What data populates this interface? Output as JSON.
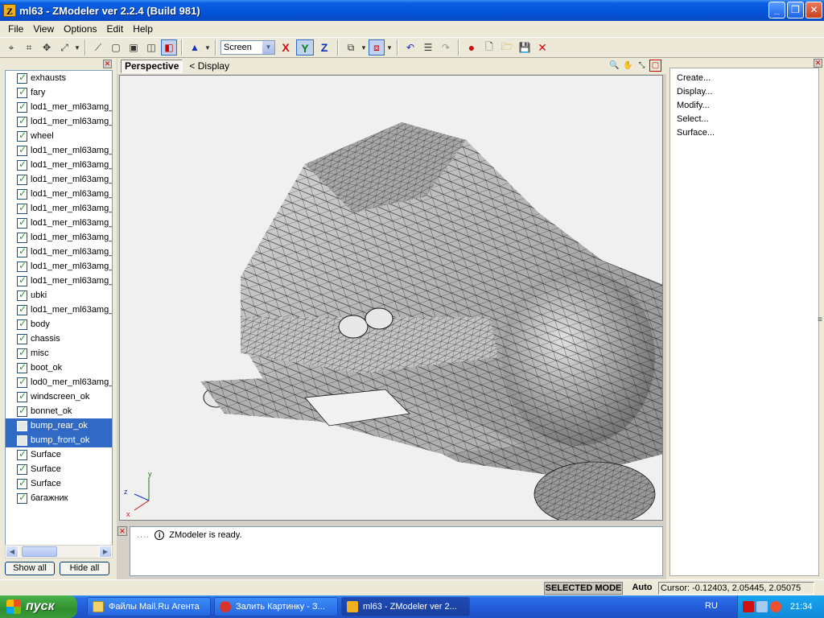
{
  "window": {
    "title": "ml63 - ZModeler ver 2.2.4 (Build 981)",
    "app_icon_letter": "Z",
    "minimize": "_",
    "maximize": "❐",
    "close": "✕"
  },
  "menu": [
    {
      "label": "File"
    },
    {
      "label": "View"
    },
    {
      "label": "Options"
    },
    {
      "label": "Edit"
    },
    {
      "label": "Help"
    }
  ],
  "toolbar": {
    "screen_select": "Screen",
    "axis_x": "X",
    "axis_y": "Y",
    "axis_z": "Z",
    "icons": [
      "select-vertex-icon",
      "select-edge-icon",
      "move-icon",
      "scale-icon",
      "create-polygon-icon",
      "box-view-icon",
      "box-solid-icon",
      "box-wire-icon",
      "box-active-icon",
      "cone-icon",
      "mapping-icon",
      "group-icon",
      "undo-icon",
      "notes-icon",
      "redo-icon",
      "record-icon",
      "new-file-icon",
      "open-file-icon",
      "save-icon",
      "delete-icon"
    ]
  },
  "objects": [
    {
      "label": "exhausts",
      "checked": true,
      "selected": false
    },
    {
      "label": "fary",
      "checked": true,
      "selected": false
    },
    {
      "label": "lod1_mer_ml63amg_(",
      "checked": true,
      "selected": false
    },
    {
      "label": "lod1_mer_ml63amg_(",
      "checked": true,
      "selected": false
    },
    {
      "label": "wheel",
      "checked": true,
      "selected": false
    },
    {
      "label": "lod1_mer_ml63amg_(",
      "checked": true,
      "selected": false
    },
    {
      "label": "lod1_mer_ml63amg_(",
      "checked": true,
      "selected": false
    },
    {
      "label": "lod1_mer_ml63amg_(",
      "checked": true,
      "selected": false
    },
    {
      "label": "lod1_mer_ml63amg_(",
      "checked": true,
      "selected": false
    },
    {
      "label": "lod1_mer_ml63amg_(",
      "checked": true,
      "selected": false
    },
    {
      "label": "lod1_mer_ml63amg_(",
      "checked": true,
      "selected": false
    },
    {
      "label": "lod1_mer_ml63amg_(",
      "checked": true,
      "selected": false
    },
    {
      "label": "lod1_mer_ml63amg_(",
      "checked": true,
      "selected": false
    },
    {
      "label": "lod1_mer_ml63amg_(",
      "checked": true,
      "selected": false
    },
    {
      "label": "lod1_mer_ml63amg_(",
      "checked": true,
      "selected": false
    },
    {
      "label": "ubki",
      "checked": true,
      "selected": false
    },
    {
      "label": "lod1_mer_ml63amg_(",
      "checked": true,
      "selected": false
    },
    {
      "label": "body",
      "checked": true,
      "selected": false
    },
    {
      "label": "chassis",
      "checked": true,
      "selected": false
    },
    {
      "label": "misc",
      "checked": true,
      "selected": false
    },
    {
      "label": "boot_ok",
      "checked": true,
      "selected": false
    },
    {
      "label": "lod0_mer_ml63amg_(",
      "checked": true,
      "selected": false
    },
    {
      "label": "windscreen_ok",
      "checked": true,
      "selected": false
    },
    {
      "label": "bonnet_ok",
      "checked": true,
      "selected": false
    },
    {
      "label": "bump_rear_ok",
      "checked": false,
      "selected": true
    },
    {
      "label": "bump_front_ok",
      "checked": false,
      "selected": true
    },
    {
      "label": "Surface",
      "checked": true,
      "selected": false
    },
    {
      "label": "Surface",
      "checked": true,
      "selected": false
    },
    {
      "label": "Surface",
      "checked": true,
      "selected": false
    },
    {
      "label": "багажник",
      "checked": true,
      "selected": false
    }
  ],
  "left_panel": {
    "show_all": "Show all",
    "hide_all": "Hide all"
  },
  "viewport": {
    "name": "Perspective",
    "display": "< Display",
    "axis_y": "y",
    "axis_z": "z",
    "axis_x": "x"
  },
  "log": {
    "dots": "....",
    "message": "ZModeler is ready."
  },
  "commands": [
    {
      "label": "Create..."
    },
    {
      "label": "Display..."
    },
    {
      "label": "Modify..."
    },
    {
      "label": "Select..."
    },
    {
      "label": "Surface..."
    }
  ],
  "statusbar": {
    "mode": "SELECTED MODE",
    "auto": "Auto",
    "cursor": "Cursor: -0.12403, 2.05445, 2.05075"
  },
  "taskbar": {
    "start": "пуск",
    "tasks": [
      {
        "label": "Файлы Mail.Ru Агента",
        "active": false
      },
      {
        "label": "Залить Картинку - З...",
        "active": false
      },
      {
        "label": "ml63 - ZModeler ver 2...",
        "active": true
      }
    ],
    "lang": "RU",
    "clock": "21:34"
  },
  "colors": {
    "titlebar": "#0554d8",
    "selection": "#316ac5",
    "model_fill": "#bdbdbd",
    "wire": "#1a1a1a"
  }
}
